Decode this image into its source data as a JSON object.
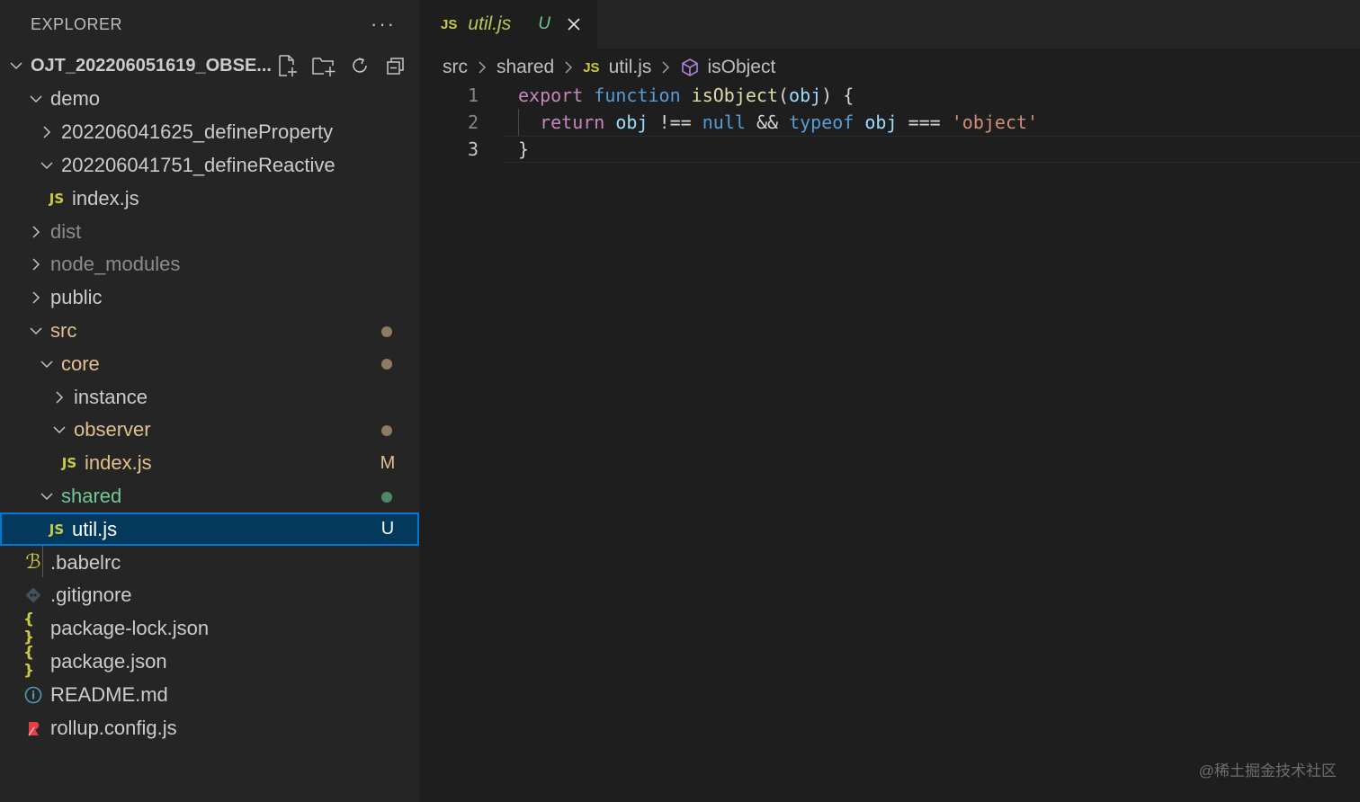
{
  "sidebar": {
    "title": "EXPLORER",
    "more_label": "···",
    "project_name": "OJT_202206051619_OBSE..."
  },
  "tree": {
    "demo": "demo",
    "define_property": "202206041625_defineProperty",
    "define_reactive": "202206041751_defineReactive",
    "demo_index": "index.js",
    "dist": "dist",
    "node_modules": "node_modules",
    "public": "public",
    "src": "src",
    "core": "core",
    "instance": "instance",
    "observer": "observer",
    "observer_index": "index.js",
    "observer_index_badge": "M",
    "shared": "shared",
    "util": "util.js",
    "util_badge": "U",
    "babelrc": ".babelrc",
    "gitignore": ".gitignore",
    "package_lock": "package-lock.json",
    "package_json": "package.json",
    "readme": "README.md",
    "rollup": "rollup.config.js"
  },
  "icons": {
    "js": "JS",
    "json": "{ }",
    "babel": "ℬ",
    "info": "i"
  },
  "tab": {
    "name": "util.js",
    "status": "U"
  },
  "breadcrumb": {
    "seg1": "src",
    "seg2": "shared",
    "seg3": "util.js",
    "seg4": "isObject"
  },
  "code": {
    "line_numbers": [
      "1",
      "2",
      "3"
    ],
    "l1": {
      "export": "export",
      "function": "function",
      "name": "isObject",
      "open": "(",
      "param": "obj",
      "close": ") {"
    },
    "l2": {
      "return": "return",
      "obj1": "obj",
      "neq": "!==",
      "null": "null",
      "and": "&&",
      "typeof": "typeof",
      "obj2": "obj",
      "eq": "===",
      "str": "'object'"
    },
    "l3": {
      "brace": "}"
    }
  },
  "watermark": "@稀土掘金技术社区",
  "colors": {
    "modified": "#e2c08d",
    "untracked": "#73c991",
    "selection": "#04395e",
    "focus_border": "#0078d4"
  }
}
